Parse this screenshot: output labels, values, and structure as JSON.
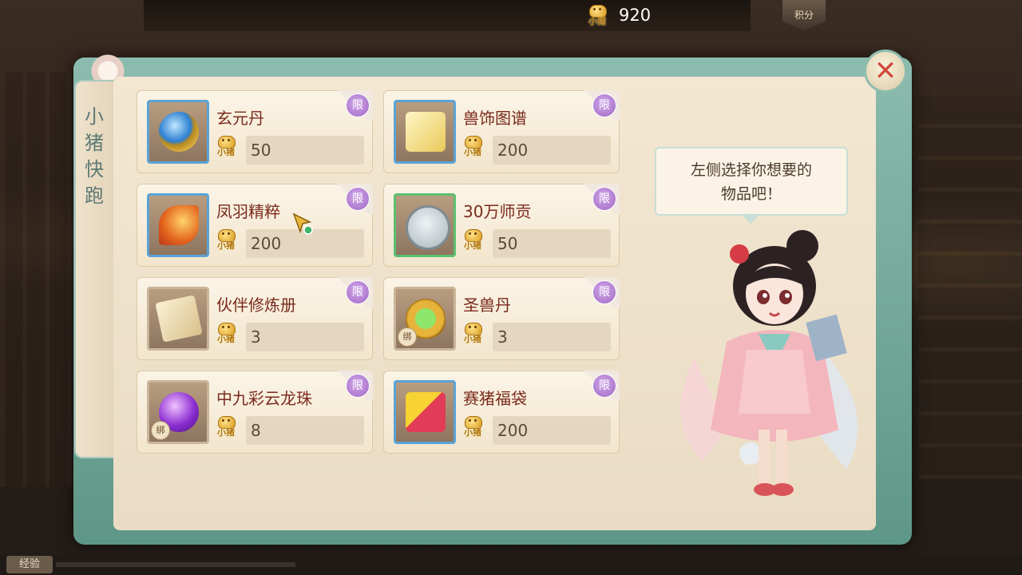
{
  "header": {
    "currency_icon": "pig-coin-icon",
    "currency_label": "小猪",
    "currency_amount": "920",
    "score_badge": "积分"
  },
  "panel": {
    "title": "小猪快跑",
    "close_icon": "close-icon"
  },
  "items": [
    {
      "name": "玄元丹",
      "price": "50",
      "limit": "限",
      "icon": "orb-cauldron-icon",
      "bound": false
    },
    {
      "name": "兽饰图谱",
      "price": "200",
      "limit": "限",
      "icon": "scroll-icon",
      "bound": false
    },
    {
      "name": "凤羽精粹",
      "price": "200",
      "limit": "限",
      "icon": "phoenix-feather-icon",
      "bound": false
    },
    {
      "name": "30万师贡",
      "price": "50",
      "limit": "限",
      "icon": "tribute-coin-icon",
      "bound": false
    },
    {
      "name": "伙伴修炼册",
      "price": "3",
      "limit": "限",
      "icon": "training-book-icon",
      "bound": false
    },
    {
      "name": "圣兽丹",
      "price": "3",
      "limit": "限",
      "icon": "beast-pill-icon",
      "bound": true
    },
    {
      "name": "中九彩云龙珠",
      "price": "8",
      "limit": "限",
      "icon": "dragon-pearl-icon",
      "bound": true
    },
    {
      "name": "赛猪福袋",
      "price": "200",
      "limit": "限",
      "icon": "lucky-bag-icon",
      "bound": false
    }
  ],
  "price_currency_label": "小猪",
  "bound_label": "绑",
  "npc": {
    "hint_line1": "左侧选择你想要的",
    "hint_line2": "物品吧！"
  },
  "footer": {
    "exp_label": "经验"
  }
}
